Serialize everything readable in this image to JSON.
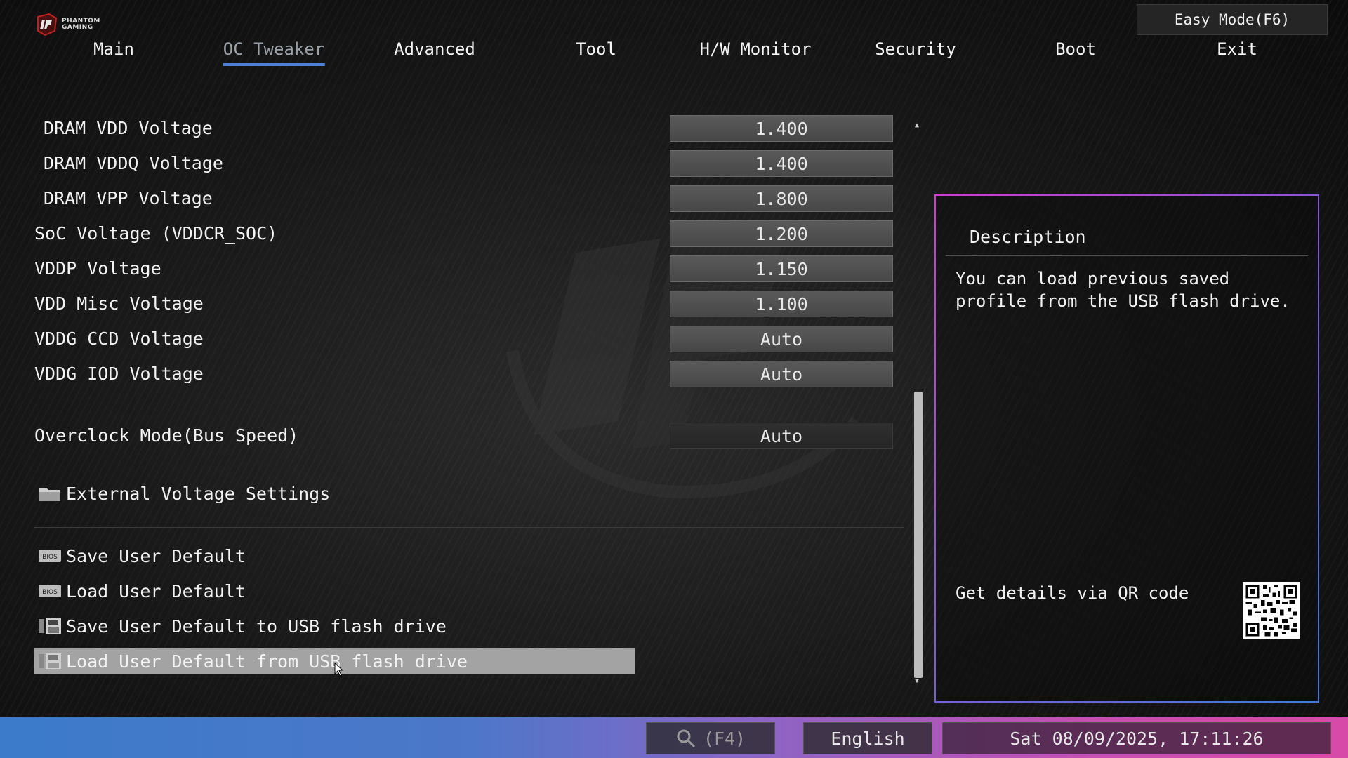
{
  "brand": {
    "line1": "PHANTOM",
    "line2": "GAMING",
    "logo_icon": "phantom-gaming-logo"
  },
  "easy_mode_label": "Easy Mode(F6)",
  "tabs": [
    {
      "label": "Main"
    },
    {
      "label": "OC Tweaker",
      "active": true
    },
    {
      "label": "Advanced"
    },
    {
      "label": "Tool"
    },
    {
      "label": "H/W Monitor"
    },
    {
      "label": "Security"
    },
    {
      "label": "Boot"
    },
    {
      "label": "Exit"
    }
  ],
  "settings": [
    {
      "label": "DRAM VDD Voltage",
      "value": "1.400"
    },
    {
      "label": "DRAM VDDQ Voltage",
      "value": "1.400"
    },
    {
      "label": "DRAM VPP Voltage",
      "value": "1.800"
    },
    {
      "label": "SoC Voltage (VDDCR_SOC)",
      "value": "1.200"
    },
    {
      "label": "VDDP Voltage",
      "value": "1.150"
    },
    {
      "label": "VDD Misc Voltage",
      "value": "1.100"
    },
    {
      "label": "VDDG CCD Voltage",
      "value": "Auto"
    },
    {
      "label": "VDDG IOD Voltage",
      "value": "Auto"
    },
    {
      "label": "Overclock Mode(Bus Speed)",
      "value": "Auto"
    }
  ],
  "submenu": {
    "label": "External Voltage Settings",
    "icon": "folder-icon"
  },
  "actions": [
    {
      "label": "Save User Default",
      "icon": "bios-chip-icon"
    },
    {
      "label": "Load User Default",
      "icon": "bios-chip-icon"
    },
    {
      "label": "Save User Default to USB flash drive",
      "icon": "floppy-disk-icon"
    },
    {
      "label": "Load User Default from USB flash drive",
      "icon": "floppy-disk-icon",
      "selected": true
    }
  ],
  "description": {
    "title": "Description",
    "text": "You can load previous saved profile from the USB flash drive.",
    "qr_label": "Get details via QR code"
  },
  "bottom_bar": {
    "search_label": "(F4)",
    "language": "English",
    "datetime": "Sat 08/09/2025, 17:11:26"
  },
  "colors": {
    "tab_underline": "#4e7fd6",
    "selected_row": "#a3a3a3",
    "panel_border_start": "#d23ad6",
    "panel_border_end": "#3e7ad8",
    "bottom_bar_start": "#3b7bc9",
    "bottom_bar_end": "#d94aa8"
  }
}
